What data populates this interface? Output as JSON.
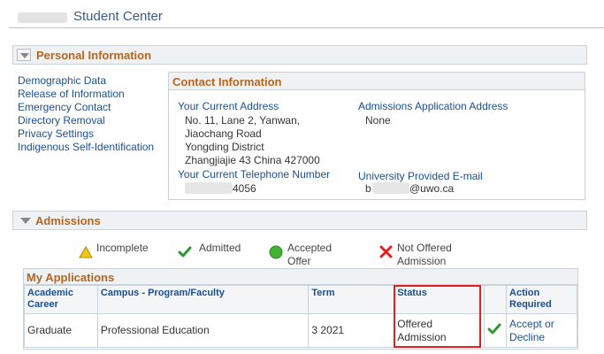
{
  "header": {
    "title": "Student Center"
  },
  "personal": {
    "title": "Personal Information",
    "links": [
      "Demographic Data",
      "Release of Information",
      "Emergency Contact",
      "Directory Removal",
      "Privacy Settings",
      "Indigenous Self-Identification"
    ],
    "contact": {
      "title": "Contact Information",
      "current_address_label": "Your Current Address",
      "current_address_lines": [
        "No. 11, Lane 2, Yanwan,",
        "Jiaochang Road",
        "Yongding District",
        "Zhangjiajie 43 China 427000"
      ],
      "admissions_address_label": "Admissions Application Address",
      "admissions_address_value": "None",
      "phone_label": "Your Current Telephone Number",
      "phone_value": "4056",
      "email_label": "University Provided E-mail",
      "email_prefix": "b",
      "email_suffix": "@uwo.ca"
    }
  },
  "admissions": {
    "title": "Admissions",
    "legend": [
      {
        "line1": "Incomplete",
        "line2": "",
        "icon": "warning-triangle-icon"
      },
      {
        "line1": "Admitted",
        "line2": "",
        "icon": "check-icon"
      },
      {
        "line1": "Accepted",
        "line2": "Offer",
        "icon": "green-circle-icon"
      },
      {
        "line1": "Not Offered",
        "line2": "Admission",
        "icon": "red-x-icon"
      }
    ],
    "applications": {
      "title": "My Applications",
      "columns": [
        "Academic Career",
        "Campus - Program/Faculty",
        "Term",
        "Status",
        "",
        "Action Required"
      ],
      "row": {
        "career": "Graduate",
        "program": "Professional Education",
        "term": "3 2021",
        "status": "Offered Admission",
        "action": "Accept or Decline"
      }
    }
  },
  "colors": {
    "accent": "#b5651d",
    "link": "#1a4f8f",
    "highlight": "#e02020"
  }
}
